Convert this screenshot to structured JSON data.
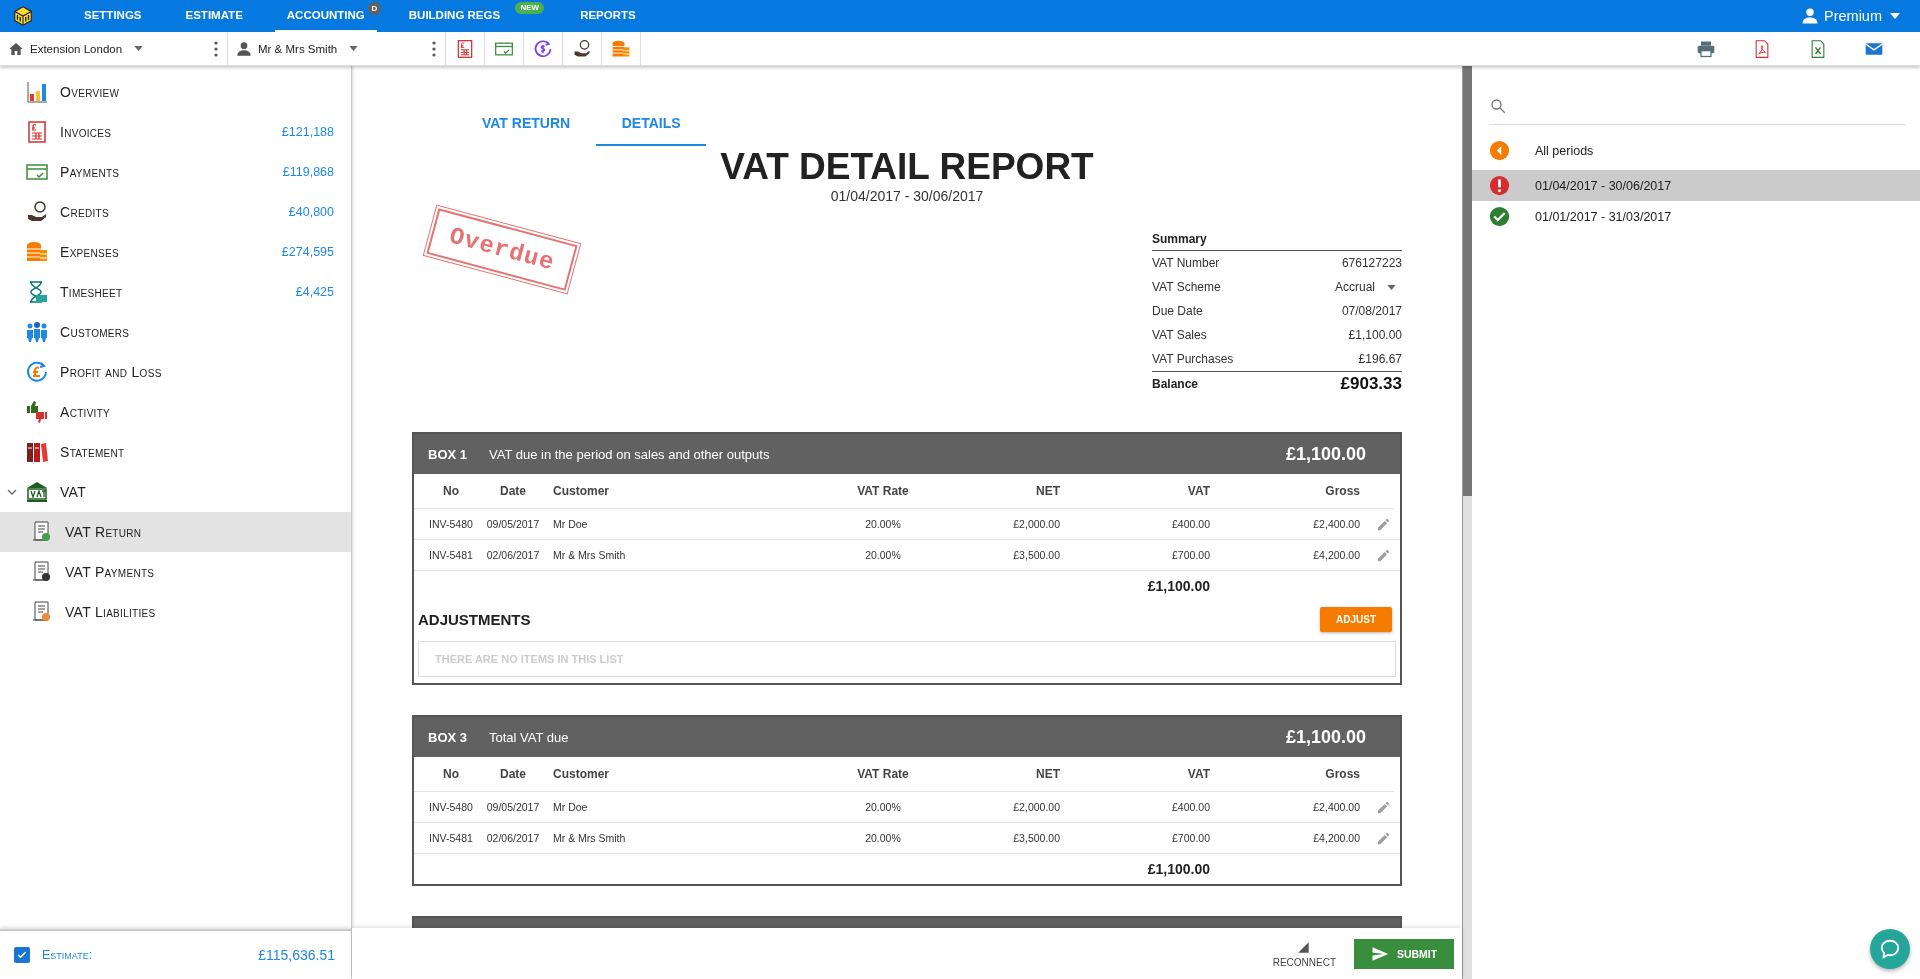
{
  "top_nav": {
    "tabs": [
      {
        "label": "SETTINGS",
        "selected": false
      },
      {
        "label": "ESTIMATE",
        "selected": false
      },
      {
        "label": "ACCOUNTING",
        "selected": true,
        "badge": {
          "text": "D",
          "color": "#616161"
        }
      },
      {
        "label": "BUILDING REGS",
        "selected": false,
        "badge": {
          "text": "NEW",
          "color": "#4caf50"
        }
      },
      {
        "label": "REPORTS",
        "selected": false
      }
    ],
    "user": "Premium"
  },
  "toolbar": {
    "project": "Extension London",
    "client": "Mr & Mrs Smith"
  },
  "sidebar": {
    "items": [
      {
        "label": "Overview",
        "selected": false
      },
      {
        "label": "Invoices",
        "amount": "£121,188",
        "selected": false
      },
      {
        "label": "Payments",
        "amount": "£119,868",
        "selected": false
      },
      {
        "label": "Credits",
        "amount": "£40,800",
        "selected": false
      },
      {
        "label": "Expenses",
        "amount": "£274,595",
        "selected": false
      },
      {
        "label": "Timesheet",
        "amount": "£4,425",
        "selected": false
      },
      {
        "label": "Customers",
        "selected": false
      },
      {
        "label": "Profit and Loss",
        "selected": false
      },
      {
        "label": "Activity",
        "selected": false
      },
      {
        "label": "Statement",
        "selected": false
      },
      {
        "label": "VAT",
        "selected": false,
        "expanded": true,
        "children": [
          {
            "label": "VAT Return",
            "selected": true
          },
          {
            "label": "VAT Payments",
            "selected": false
          },
          {
            "label": "VAT Liabilities",
            "selected": false
          }
        ]
      }
    ],
    "footer": {
      "label": "Estimate:",
      "value": "£115,636.51",
      "checked": true
    }
  },
  "report": {
    "tabs": [
      {
        "label": "VAT RETURN",
        "selected": false
      },
      {
        "label": "DETAILS",
        "selected": true
      }
    ],
    "title": "VAT DETAIL REPORT",
    "period": "01/04/2017 - 30/06/2017",
    "stamp": "Overdue",
    "summary": {
      "title": "Summary",
      "rows": [
        {
          "label": "VAT Number",
          "value": "676127223",
          "kind": "text"
        },
        {
          "label": "VAT Scheme",
          "value": "Accrual",
          "kind": "select"
        },
        {
          "label": "Due Date",
          "value": "07/08/2017",
          "kind": "text"
        },
        {
          "label": "VAT Sales",
          "value": "£1,100.00",
          "kind": "text"
        },
        {
          "label": "VAT Purchases",
          "value": "£196.67",
          "kind": "text"
        }
      ],
      "balance": {
        "label": "Balance",
        "value": "£903.33"
      }
    },
    "boxes": [
      {
        "code": "BOX 1",
        "title": "VAT due in the period on sales and other outputs",
        "amount": "£1,100.00",
        "columns": [
          "No",
          "Date",
          "Customer",
          "VAT Rate",
          "NET",
          "VAT",
          "Gross"
        ],
        "rows": [
          [
            "INV-5480",
            "09/05/2017",
            "Mr Doe",
            "20.00%",
            "£2,000.00",
            "£400.00",
            "£2,400.00"
          ],
          [
            "INV-5481",
            "02/06/2017",
            "Mr & Mrs Smith",
            "20.00%",
            "£3,500.00",
            "£700.00",
            "£4,200.00"
          ]
        ],
        "total": "£1,100.00",
        "adjustments": {
          "title": "ADJUSTMENTS",
          "button": "ADJUST",
          "empty": "THERE ARE NO ITEMS IN THIS LIST"
        }
      },
      {
        "code": "BOX 3",
        "title": "Total VAT due",
        "amount": "£1,100.00",
        "columns": [
          "No",
          "Date",
          "Customer",
          "VAT Rate",
          "NET",
          "VAT",
          "Gross"
        ],
        "rows": [
          [
            "INV-5480",
            "09/05/2017",
            "Mr Doe",
            "20.00%",
            "£2,000.00",
            "£400.00",
            "£2,400.00"
          ],
          [
            "INV-5481",
            "02/06/2017",
            "Mr & Mrs Smith",
            "20.00%",
            "£3,500.00",
            "£700.00",
            "£4,200.00"
          ]
        ],
        "total": "£1,100.00"
      }
    ]
  },
  "bottom_bar": {
    "reconnect": "RECONNECT",
    "submit": "SUBMIT"
  },
  "periods": [
    {
      "label": "All periods",
      "kind": "back",
      "selected": false
    },
    {
      "label": "01/04/2017 - 30/06/2017",
      "kind": "overdue",
      "selected": true
    },
    {
      "label": "01/01/2017 - 31/03/2017",
      "kind": "done",
      "selected": false
    }
  ]
}
